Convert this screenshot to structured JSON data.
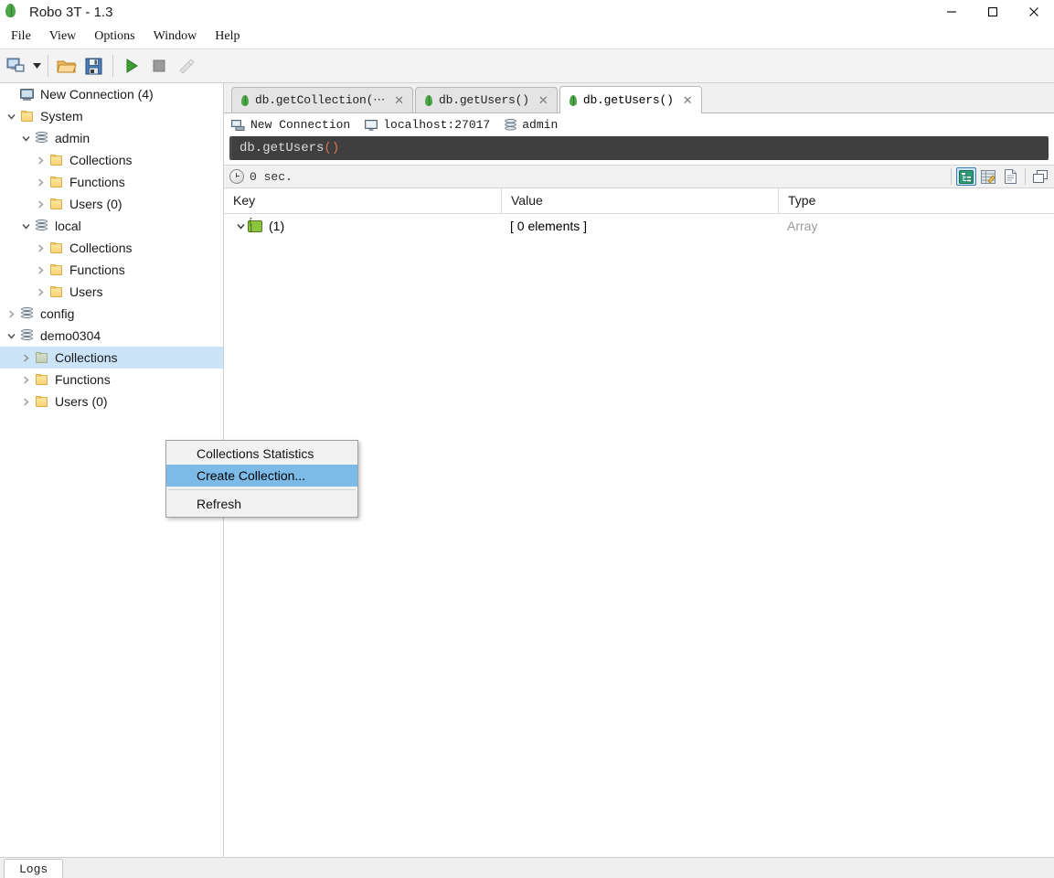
{
  "window": {
    "title": "Robo 3T - 1.3",
    "app_icon": "mongodb-leaf-icon",
    "controls": {
      "minimize": "—",
      "maximize": "☐",
      "close": "✕"
    }
  },
  "menubar": {
    "items": [
      {
        "label": "File"
      },
      {
        "label": "View"
      },
      {
        "label": "Options"
      },
      {
        "label": "Window"
      },
      {
        "label": "Help"
      }
    ]
  },
  "toolbar": {
    "buttons": [
      {
        "name": "connect-button",
        "icon": "computer-connect-icon"
      },
      {
        "name": "connect-dropdown",
        "icon": "chevron-down-icon"
      },
      {
        "name": "open-script-button",
        "icon": "open-folder-icon"
      },
      {
        "name": "save-script-button",
        "icon": "floppy-save-icon"
      },
      {
        "name": "execute-button",
        "icon": "play-triangle-icon"
      },
      {
        "name": "stop-button",
        "icon": "stop-square-icon"
      },
      {
        "name": "explain-button",
        "icon": "wrench-icon"
      }
    ]
  },
  "sidebar": {
    "tree": [
      {
        "label": "New Connection (4)",
        "icon": "computer-icon",
        "indent": 0,
        "twisty": "",
        "selected": false
      },
      {
        "label": "System",
        "icon": "folder-icon",
        "indent": 1,
        "twisty": "open",
        "selected": false
      },
      {
        "label": "admin",
        "icon": "database-icon",
        "indent": 2,
        "twisty": "open",
        "selected": false
      },
      {
        "label": "Collections",
        "icon": "folder-icon",
        "indent": 3,
        "twisty": "closed",
        "selected": false
      },
      {
        "label": "Functions",
        "icon": "folder-icon",
        "indent": 3,
        "twisty": "closed",
        "selected": false
      },
      {
        "label": "Users (0)",
        "icon": "folder-icon",
        "indent": 3,
        "twisty": "closed",
        "selected": false
      },
      {
        "label": "local",
        "icon": "database-icon",
        "indent": 2,
        "twisty": "open",
        "selected": false
      },
      {
        "label": "Collections",
        "icon": "folder-icon",
        "indent": 3,
        "twisty": "closed",
        "selected": false
      },
      {
        "label": "Functions",
        "icon": "folder-icon",
        "indent": 3,
        "twisty": "closed",
        "selected": false
      },
      {
        "label": "Users",
        "icon": "folder-icon",
        "indent": 3,
        "twisty": "closed",
        "selected": false
      },
      {
        "label": "config",
        "icon": "database-icon",
        "indent": 1,
        "twisty": "closed",
        "selected": false
      },
      {
        "label": "demo0304",
        "icon": "database-icon",
        "indent": 1,
        "twisty": "open",
        "selected": false
      },
      {
        "label": "Collections",
        "icon": "folder-muted-icon",
        "indent": 2,
        "twisty": "closed",
        "selected": true
      },
      {
        "label": "Functions",
        "icon": "folder-icon",
        "indent": 2,
        "twisty": "closed",
        "selected": false
      },
      {
        "label": "Users (0)",
        "icon": "folder-icon",
        "indent": 2,
        "twisty": "closed",
        "selected": false
      }
    ]
  },
  "context_menu": {
    "items": [
      {
        "label": "Collections Statistics",
        "highlighted": false,
        "separator_after": false
      },
      {
        "label": "Create Collection...",
        "highlighted": true,
        "separator_after": true
      },
      {
        "label": "Refresh",
        "highlighted": false,
        "separator_after": false
      }
    ]
  },
  "tabs": [
    {
      "label": "db.getCollection(⋯",
      "active": false,
      "icon": "mongodb-leaf-icon",
      "close": "✕"
    },
    {
      "label": "db.getUsers()",
      "active": false,
      "icon": "mongodb-leaf-icon",
      "close": "✕"
    },
    {
      "label": "db.getUsers()",
      "active": true,
      "icon": "mongodb-leaf-icon",
      "close": "✕"
    }
  ],
  "connection_info": {
    "connection_name": "New Connection",
    "host": "localhost:27017",
    "database": "admin"
  },
  "editor": {
    "code_main": "db.getUsers",
    "code_paren": "()"
  },
  "results_toolbar": {
    "elapsed": "0 sec.",
    "view_modes": [
      {
        "name": "tree-view-button",
        "icon": "tree-view-icon",
        "active": true
      },
      {
        "name": "table-view-button",
        "icon": "table-view-icon",
        "active": false
      },
      {
        "name": "text-view-button",
        "icon": "text-document-icon",
        "active": false
      }
    ],
    "detach_button": {
      "name": "detach-window-button",
      "icon": "window-duplicate-icon"
    }
  },
  "results": {
    "columns": [
      "Key",
      "Value",
      "Type"
    ],
    "rows": [
      {
        "key": "(1)",
        "value": "[ 0 elements ]",
        "type": "Array",
        "icon": "array-icon",
        "expanded": true
      }
    ]
  },
  "statusbar": {
    "logs_tab": "Logs"
  },
  "colors": {
    "accent_selection": "#cbe4f7",
    "menu_highlight": "#7cbbe8",
    "mongo_green": "#4ca546",
    "editor_bg": "#3f3f3f",
    "editor_paren": "#d9734a",
    "array_green": "#8cc63f"
  }
}
